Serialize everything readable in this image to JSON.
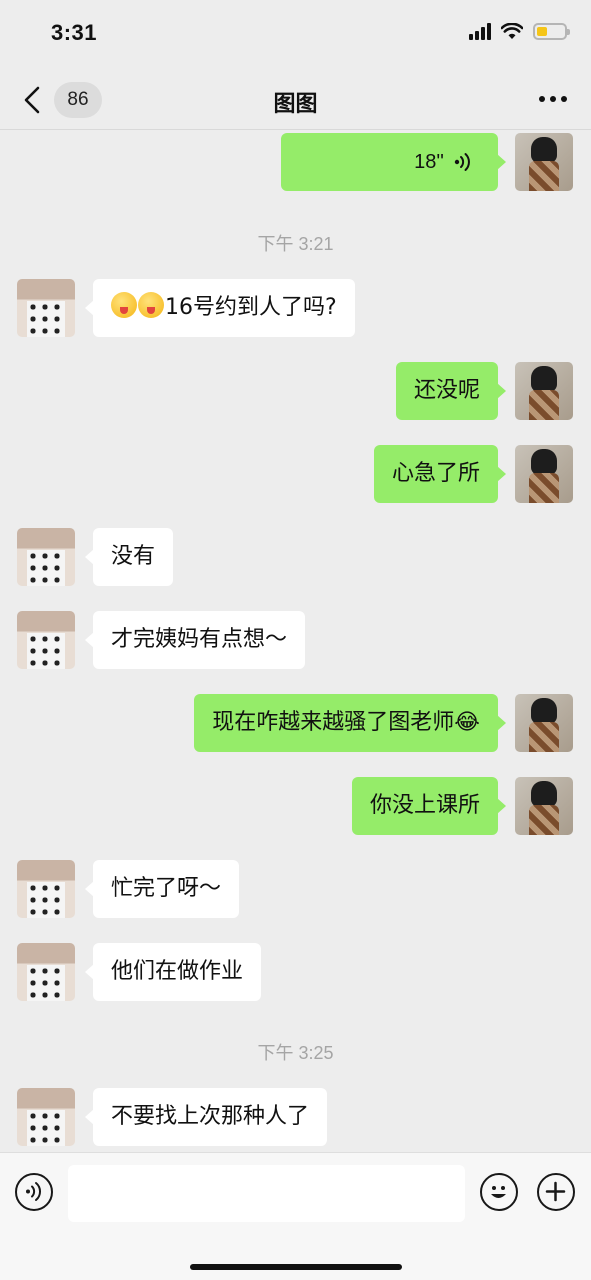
{
  "status_bar": {
    "time": "3:31"
  },
  "nav": {
    "back_count": "86",
    "title": "图图"
  },
  "messages": [
    {
      "side": "right",
      "type": "voice",
      "duration": "18''"
    },
    {
      "side": "center",
      "type": "time",
      "text": "下午 3:21"
    },
    {
      "side": "left",
      "type": "text",
      "emoji_count": 2,
      "text": "16号约到人了吗?"
    },
    {
      "side": "right",
      "type": "text",
      "text": "还没呢"
    },
    {
      "side": "right",
      "type": "text",
      "text": "心急了所"
    },
    {
      "side": "left",
      "type": "text",
      "text": "没有"
    },
    {
      "side": "left",
      "type": "text",
      "text": "才完姨妈有点想～"
    },
    {
      "side": "right",
      "type": "text",
      "text": "现在咋越来越骚了图老师",
      "trailing_emoji": "😂"
    },
    {
      "side": "right",
      "type": "text",
      "text": "你没上课所"
    },
    {
      "side": "left",
      "type": "text",
      "text": "忙完了呀～"
    },
    {
      "side": "left",
      "type": "text",
      "text": "他们在做作业"
    },
    {
      "side": "center",
      "type": "time",
      "text": "下午 3:25"
    },
    {
      "side": "left",
      "type": "text",
      "text": "不要找上次那种人了"
    }
  ],
  "input": {
    "value": "",
    "placeholder": ""
  },
  "colors": {
    "background": "#ededed",
    "my_bubble": "#95ec69",
    "their_bubble": "#ffffff",
    "timestamp": "#a5a5a5"
  }
}
